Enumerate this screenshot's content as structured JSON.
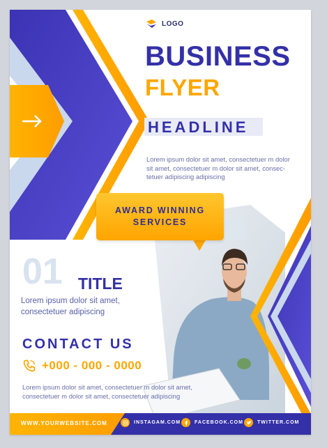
{
  "brand": {
    "logo_text": "LOGO"
  },
  "title": {
    "line1": "BUSINESS",
    "line2": "FLYER"
  },
  "headline": {
    "text": "HEADLINE",
    "description": "Lorem ipsum dolor sit amet, consectetuer m dolor sit amet, consectetuer m dolor sit amet, consec- tetuer adipiscing adipiscing"
  },
  "award": {
    "line1": "AWARD WINNING",
    "line2": "SERVICES"
  },
  "section": {
    "number": "01",
    "title": "TITLE",
    "description": "Lorem ipsum dolor sit amet, consectetuer adipiscing"
  },
  "contact": {
    "heading": "CONTACT US",
    "phone": "+000 - 000 - 0000",
    "description": "Lorem ipsum dolor sit amet, consectetuer m dolor sit amet, consectetuer m dolor sit amet, consectetuer adipiscing"
  },
  "footer": {
    "website": "WWW.YOURWEBSITE.COM",
    "instagram": "INSTAGAM.COM",
    "facebook": "FACEBOOK.COM",
    "twitter": "TWITTER.COM"
  },
  "colors": {
    "primary": "#3430a8",
    "accent": "#ffa600",
    "light": "#e8ebf6"
  }
}
